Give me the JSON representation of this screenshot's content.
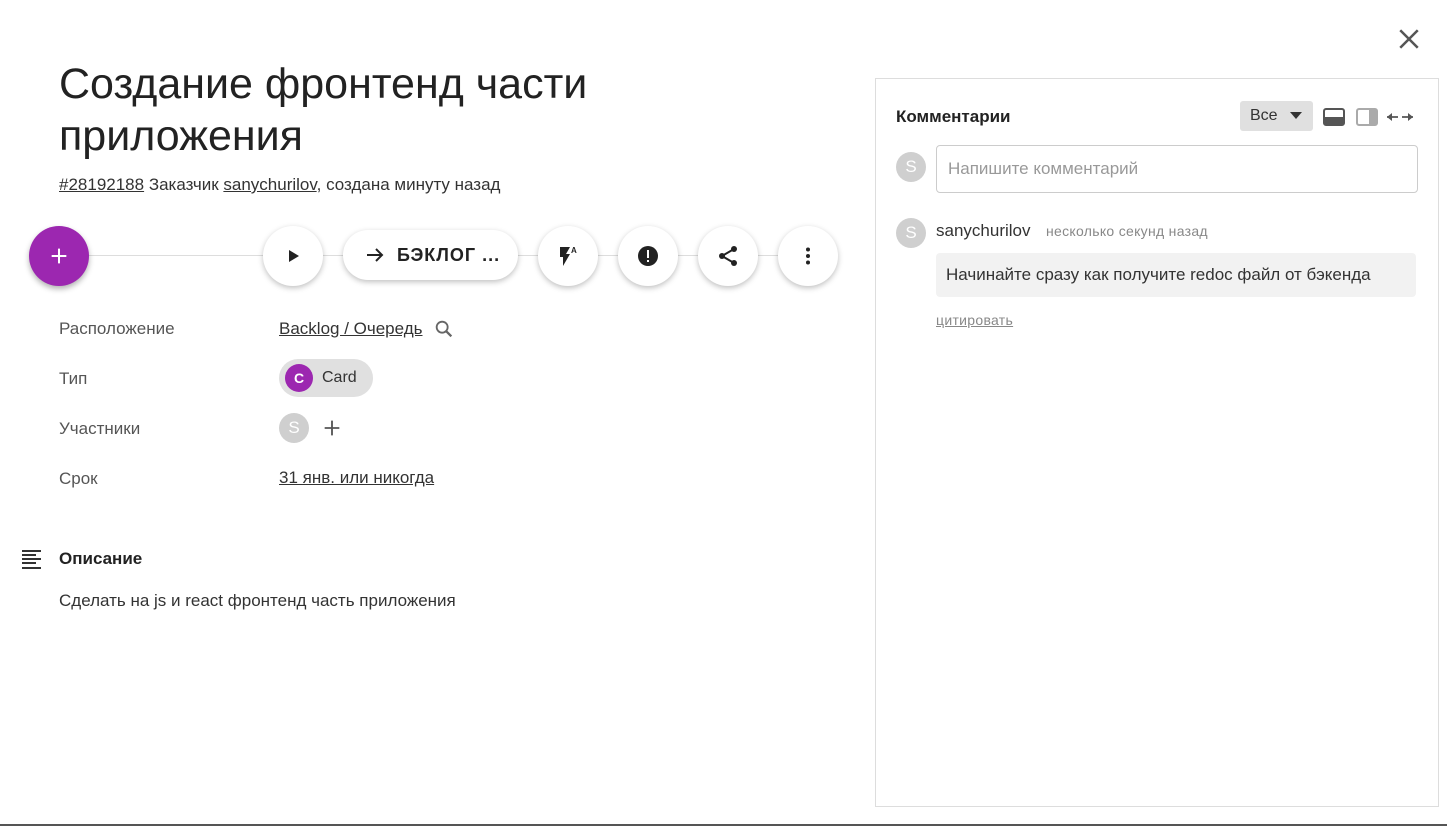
{
  "card": {
    "title": "Создание фронтенд части приложения",
    "id": "#28192188",
    "customer_prefix": "Заказчик",
    "customer": "sanychurilov",
    "created": ", создана минуту назад"
  },
  "actions": {
    "add": "+",
    "backlog_label": "БЭКЛОГ ...",
    "icons": [
      "play-icon",
      "arrow-right-icon",
      "flash-auto-icon",
      "priority-icon",
      "share-icon",
      "more-vert-icon"
    ]
  },
  "properties": {
    "location_label": "Расположение",
    "location_value": "Backlog / Очередь",
    "type_label": "Тип",
    "type_avatar": "C",
    "type_value": "Card",
    "members_label": "Участники",
    "member_avatar": "S",
    "due_label": "Срок",
    "due_value": "31 янв. или никогда"
  },
  "description": {
    "title": "Описание",
    "text": "Сделать на js и react фронтенд часть приложения"
  },
  "comments": {
    "title": "Комментарии",
    "filter": "Все",
    "input_placeholder": "Напишите комментарий",
    "current_user_avatar": "S",
    "items": [
      {
        "avatar": "S",
        "author": "sanychurilov",
        "time": "несколько секунд назад",
        "text": "Начинайте сразу как получите redoc файл от бэкенда",
        "quote": "цитировать"
      }
    ]
  },
  "colors": {
    "accent": "#9c27b0",
    "chip_bg": "#e0e0e0",
    "avatar_grey": "#cfcfcf"
  }
}
